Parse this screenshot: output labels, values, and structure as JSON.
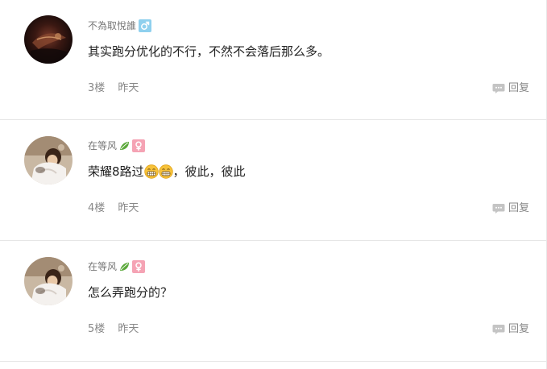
{
  "comments": [
    {
      "username": "不為取悅誰",
      "gender": "male",
      "gender_symbol": "♂",
      "content": "其实跑分优化的不行，不然不会落后那么多。",
      "floor": "3楼",
      "time": "昨天",
      "reply_label": "回复"
    },
    {
      "username": "在等风",
      "gender": "female",
      "gender_symbol": "♀",
      "content_before": "荣耀8路过",
      "content_after": "，彼此，彼此",
      "floor": "4楼",
      "time": "昨天",
      "reply_label": "回复"
    },
    {
      "username": "在等风",
      "gender": "female",
      "gender_symbol": "♀",
      "content": "怎么弄跑分的？",
      "floor": "5楼",
      "time": "昨天",
      "reply_label": "回复"
    }
  ],
  "colors": {
    "male_badge": "#8fd0ee",
    "female_badge": "#f5a3b4",
    "leaf": "#5aa83a",
    "divider": "#e6e6e6"
  }
}
